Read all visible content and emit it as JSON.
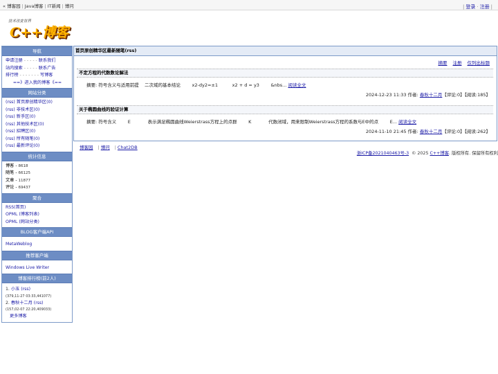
{
  "topbar": {
    "prefix": "«",
    "items": [
      "博客园",
      "Java博客",
      "IT新闻",
      "博问"
    ],
    "right": [
      "登录",
      "注册"
    ]
  },
  "logo": {
    "tagline": "技术改变世界",
    "title": "C++博客"
  },
  "sidebar": {
    "nav": {
      "header": "导航",
      "rows": [
        {
          "a": "申请注册",
          "dash": "- - - - -",
          "b": "联系我们"
        },
        {
          "a": "站内搜索",
          "dash": "- - - - -",
          "b": "联系广告"
        },
        {
          "a": "排行榜",
          "dash": "- - - - - - -",
          "b": "写博客"
        }
      ],
      "enter": "==》进入我的博客《=="
    },
    "categories": {
      "header": "网站分类",
      "items": [
        "(rss) 首页原创精华区(0)",
        "(rss) 非技术区(0)",
        "(rss) 新手区(0)",
        "(rss) 其他技术区(0)",
        "(rss) 招聘区(0)",
        "(rss) 所有随笔(0)",
        "(rss) 最新评论(0)"
      ]
    },
    "stats": {
      "header": "统计信息",
      "items": [
        {
          "label": "博客",
          "value": "8618"
        },
        {
          "label": "随笔",
          "value": "66125"
        },
        {
          "label": "文章",
          "value": "11877"
        },
        {
          "label": "评论",
          "value": "69437"
        }
      ]
    },
    "aggregate": {
      "header": "聚合",
      "items": [
        "RSS(首页)",
        "OPML (博客列表)",
        "OPML (网站分类)"
      ]
    },
    "api": {
      "header": "BLOG客户端API",
      "items": [
        "MetaWeblog"
      ]
    },
    "client": {
      "header": "推荐客户端",
      "items": [
        "Windows Live Writer"
      ]
    },
    "ranking": {
      "header": "博客排行榜(前2人)",
      "items": [
        {
          "index": "1.",
          "name": "小玉",
          "rss": "(rss)",
          "sub": "(379,11-27 03:33,441077)"
        },
        {
          "index": "2.",
          "name": "春秋十二月",
          "rss": "(rss)",
          "sub": "(157,02-07 22:20,409033)"
        }
      ],
      "more": "更多博客"
    }
  },
  "main": {
    "header": "首页原创精华区最新随笔(rss)",
    "links": [
      "摘要",
      "注册",
      "仅列出标题"
    ],
    "posts": [
      {
        "title": "不定方程的代数数论解法",
        "summary": "摘要: 符号含义与适用前提    二次域的基本结论        x2-dy2=±1          x2 + d = y3        &nbs...",
        "readmore": "阅读全文",
        "meta_pre": "2024-12-23 11:33 作者:",
        "author": "春秋十二月",
        "meta_post": "【评论:0】【阅读:185】"
      },
      {
        "title": "关于椭圆曲线的验证计算",
        "summary": "摘要: 符号含义        E            表示满足椭圆曲线Weierstrass方程上的点群        K            代数闭域，用来限制Weierstrass方程的系数与E中的点        E...",
        "readmore": "阅读全文",
        "meta_pre": "2024-11-10 21:45 作者:",
        "author": "春秋十二月",
        "meta_post": "【评论:0】【阅读:262】"
      }
    ]
  },
  "bottom_links": [
    "博客园",
    "博问",
    "Chat2DB"
  ],
  "footer": {
    "icp": "浙ICP备2021040463号-3",
    "copy_pre": "© 2025",
    "site": "C++博客",
    "copy_post": ". 版权所有. 保留所有权利"
  },
  "colors": {
    "header_bg": "#6d8dc4",
    "border": "#7c9ac8",
    "link": "#1a1aa6",
    "logo": "#ffb300"
  }
}
